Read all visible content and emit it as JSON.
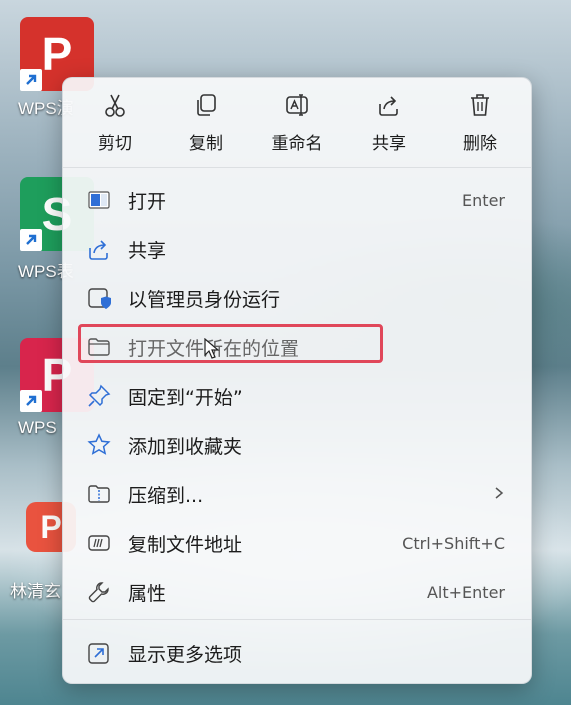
{
  "desktop": {
    "icons": [
      {
        "letter": "P",
        "label": "WPS演",
        "color": "#d5322c"
      },
      {
        "letter": "S",
        "label": "WPS表",
        "color": "#1e9e5c"
      },
      {
        "letter": "P",
        "label": "WPS",
        "color": "#d8254c"
      },
      {
        "letter": "P",
        "label": "林清玄",
        "color": "#e9533f"
      }
    ]
  },
  "toolbar": {
    "cut": "剪切",
    "copy": "复制",
    "rename": "重命名",
    "share": "共享",
    "delete": "删除"
  },
  "menu": {
    "items": [
      {
        "label": "打开",
        "shortcut": "Enter"
      },
      {
        "label": "共享",
        "shortcut": ""
      },
      {
        "label": "以管理员身份运行",
        "shortcut": ""
      },
      {
        "label": "打开文件所在的位置",
        "shortcut": ""
      },
      {
        "label": "固定到“开始”",
        "shortcut": ""
      },
      {
        "label": "添加到收藏夹",
        "shortcut": ""
      },
      {
        "label": "压缩到...",
        "shortcut": ""
      },
      {
        "label": "复制文件地址",
        "shortcut": "Ctrl+Shift+C"
      },
      {
        "label": "属性",
        "shortcut": "Alt+Enter"
      }
    ],
    "more": "显示更多选项"
  },
  "colors": {
    "accent": "#2f6fd6",
    "highlight_border": "#e0475a",
    "menu_bg": "#f7f9fa"
  }
}
